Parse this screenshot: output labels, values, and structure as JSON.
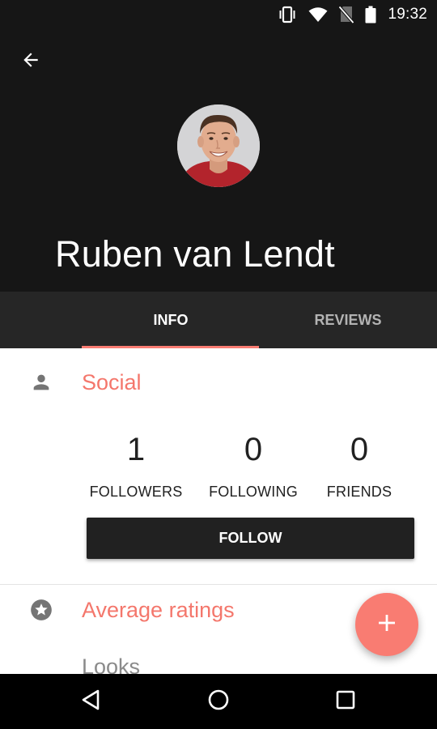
{
  "status_bar": {
    "time": "19:32",
    "icons": [
      "vibrate-icon",
      "wifi-icon",
      "no-sim-icon",
      "battery-icon"
    ]
  },
  "header": {
    "back_icon": "arrow-back-icon",
    "name": "Ruben van Lendt"
  },
  "tabs": [
    {
      "label": "INFO",
      "selected": true
    },
    {
      "label": "REVIEWS",
      "selected": false
    }
  ],
  "social": {
    "icon": "person-icon",
    "title": "Social",
    "stats": [
      {
        "value": "1",
        "label": "FOLLOWERS"
      },
      {
        "value": "0",
        "label": "FOLLOWING"
      },
      {
        "value": "0",
        "label": "FRIENDS"
      }
    ],
    "follow_label": "FOLLOW"
  },
  "ratings": {
    "icon": "star-circle-icon",
    "title": "Average ratings",
    "first_item": "Looks"
  },
  "fab": {
    "icon": "plus-icon"
  },
  "nav_bar": {
    "icons": [
      "back-triangle-icon",
      "home-circle-icon",
      "recents-square-icon"
    ]
  },
  "colors": {
    "accent": "#f97c72",
    "header_bg": "#161616",
    "tab_bar_bg": "#262626",
    "button_dark": "#212121"
  }
}
